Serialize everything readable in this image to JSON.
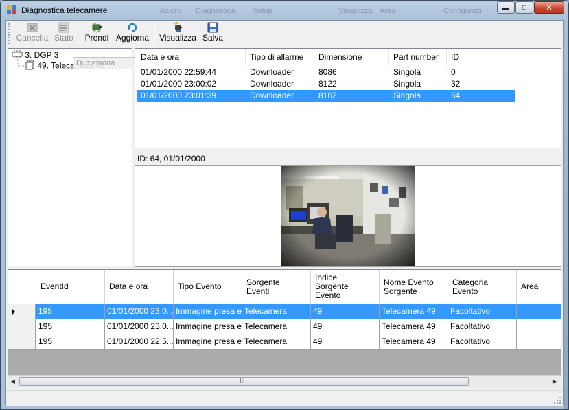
{
  "window": {
    "title": "Diagnostica telecamere",
    "bg_menu": [
      "Azioni",
      "Diagnostica",
      "Setup",
      "Visualizza",
      "Area",
      "Configurazi"
    ]
  },
  "toolbar": {
    "buttons": [
      {
        "label": "Cancella",
        "enabled": false,
        "icon": "delete-icon"
      },
      {
        "label": "Stato",
        "enabled": false,
        "icon": "status-icon"
      },
      {
        "label": "Prendi",
        "enabled": true,
        "icon": "camera-grab-icon"
      },
      {
        "label": "Aggiorna",
        "enabled": true,
        "icon": "refresh-icon"
      },
      {
        "label": "Visualizza",
        "enabled": true,
        "icon": "view-icon"
      },
      {
        "label": "Salva",
        "enabled": true,
        "icon": "save-icon"
      }
    ]
  },
  "tree": {
    "root": "3. DGP 3",
    "child": "49. Telecamera 49",
    "tooltip": "Di memoria"
  },
  "alarms": {
    "columns": [
      "Data e ora",
      "Tipo di allarme",
      "Dimensione",
      "Part number",
      "ID"
    ],
    "rows": [
      [
        "01/01/2000 22:59:44",
        "Downloader",
        "8086",
        "Singola",
        "0"
      ],
      [
        "01/01/2000 23:00:02",
        "Downloader",
        "8122",
        "Singola",
        "32"
      ],
      [
        "01/01/2000 23:01:39",
        "Downloader",
        "8162",
        "Singola",
        "64"
      ]
    ],
    "selected_index": 2
  },
  "image_info": "ID: 64, 01/01/2000",
  "events": {
    "columns": [
      "EventId",
      "Data e ora",
      "Tipo Evento",
      "Sorgente\nEventi",
      "Indice\nSorgente\nEvento",
      "Nome Evento\nSorgente",
      "Categoria\nEvento",
      "Area"
    ],
    "rows": [
      [
        "195",
        "01/01/2000 23:0...",
        "Immagine presa e...",
        "Telecamera",
        "49",
        "Telecamera 49",
        "Facoltativo",
        ""
      ],
      [
        "195",
        "01/01/2000 23:0...",
        "Immagine presa e...",
        "Telecamera",
        "49",
        "Telecamera 49",
        "Facoltativo",
        ""
      ],
      [
        "195",
        "01/01/2000 22:5...",
        "Immagine presa e...",
        "Telecamera",
        "49",
        "Telecamera 49",
        "Facoltativo",
        ""
      ]
    ],
    "selected_index": 0
  },
  "scrollbar": {
    "grip": "III"
  },
  "colors": {
    "selection": "#3399ff",
    "titlebar": "#bcd0e3",
    "close": "#c9462c"
  }
}
